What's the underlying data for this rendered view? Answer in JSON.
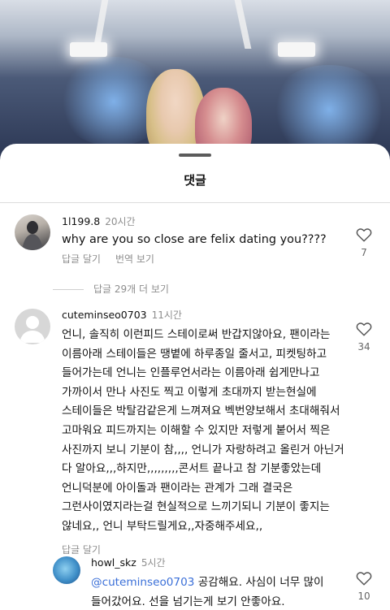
{
  "sheet": {
    "title": "댓글"
  },
  "comments": [
    {
      "username": "1l199.8",
      "time": "20시간",
      "text": "why are you so close are felix dating you????",
      "actions": [
        "답글 달기",
        "번역 보기"
      ],
      "likes": "7"
    },
    {
      "username": "cuteminseo0703",
      "time": "11시간",
      "text": "언니, 솔직히 이런피드 스테이로써 반갑지않아요, 팬이라는\n이름아래 스테이들은 땡볕에 하루종일 줄서고, 피켓팅하고\n들어가는데 언니는 인플루언서라는 이름아래 쉽게만나고\n가까이서 만나 사진도 찍고 이렇게 초대까지 받는현실에\n스테이들은 박탈감같은게 느껴져요 벡번양보해서 초대해줘서\n고마워요 피드까지는 이해할 수 있지만 저렇게 붙어서 찍은\n사진까지 보니 기분이 참,,,, 언니가 자랑하려고 올린거 아닌거\n다 알아요,,,하지만,,,,,,,,,콘서트 끝나고 참 기분좋았는데\n언니덕분에 아이돌과 팬이라는 관계가 그래 결국은\n그런사이였지라는걸 현실적으로 느끼기되니 기분이 좋지는\n않네요,, 언니 부탁드릴게요,,자중해주세요,,",
      "actions": [
        "답글 달기"
      ],
      "likes": "34"
    }
  ],
  "more_replies": "답글 29개 더 보기",
  "reply": {
    "username": "howl_skz",
    "time": "5시간",
    "mention": "@cuteminseo0703",
    "text_line1": " 공감해요. 사심이 너무 많이",
    "text_line2": "들어갔어요. 선을 넘기는게 보기 안좋아요.",
    "likes": "10"
  },
  "icons": {
    "like": "heart-outline-icon",
    "grabber": "drag-handle"
  },
  "colors": {
    "mention": "#3a6fd8",
    "secondary_text": "#8e8e8e"
  }
}
